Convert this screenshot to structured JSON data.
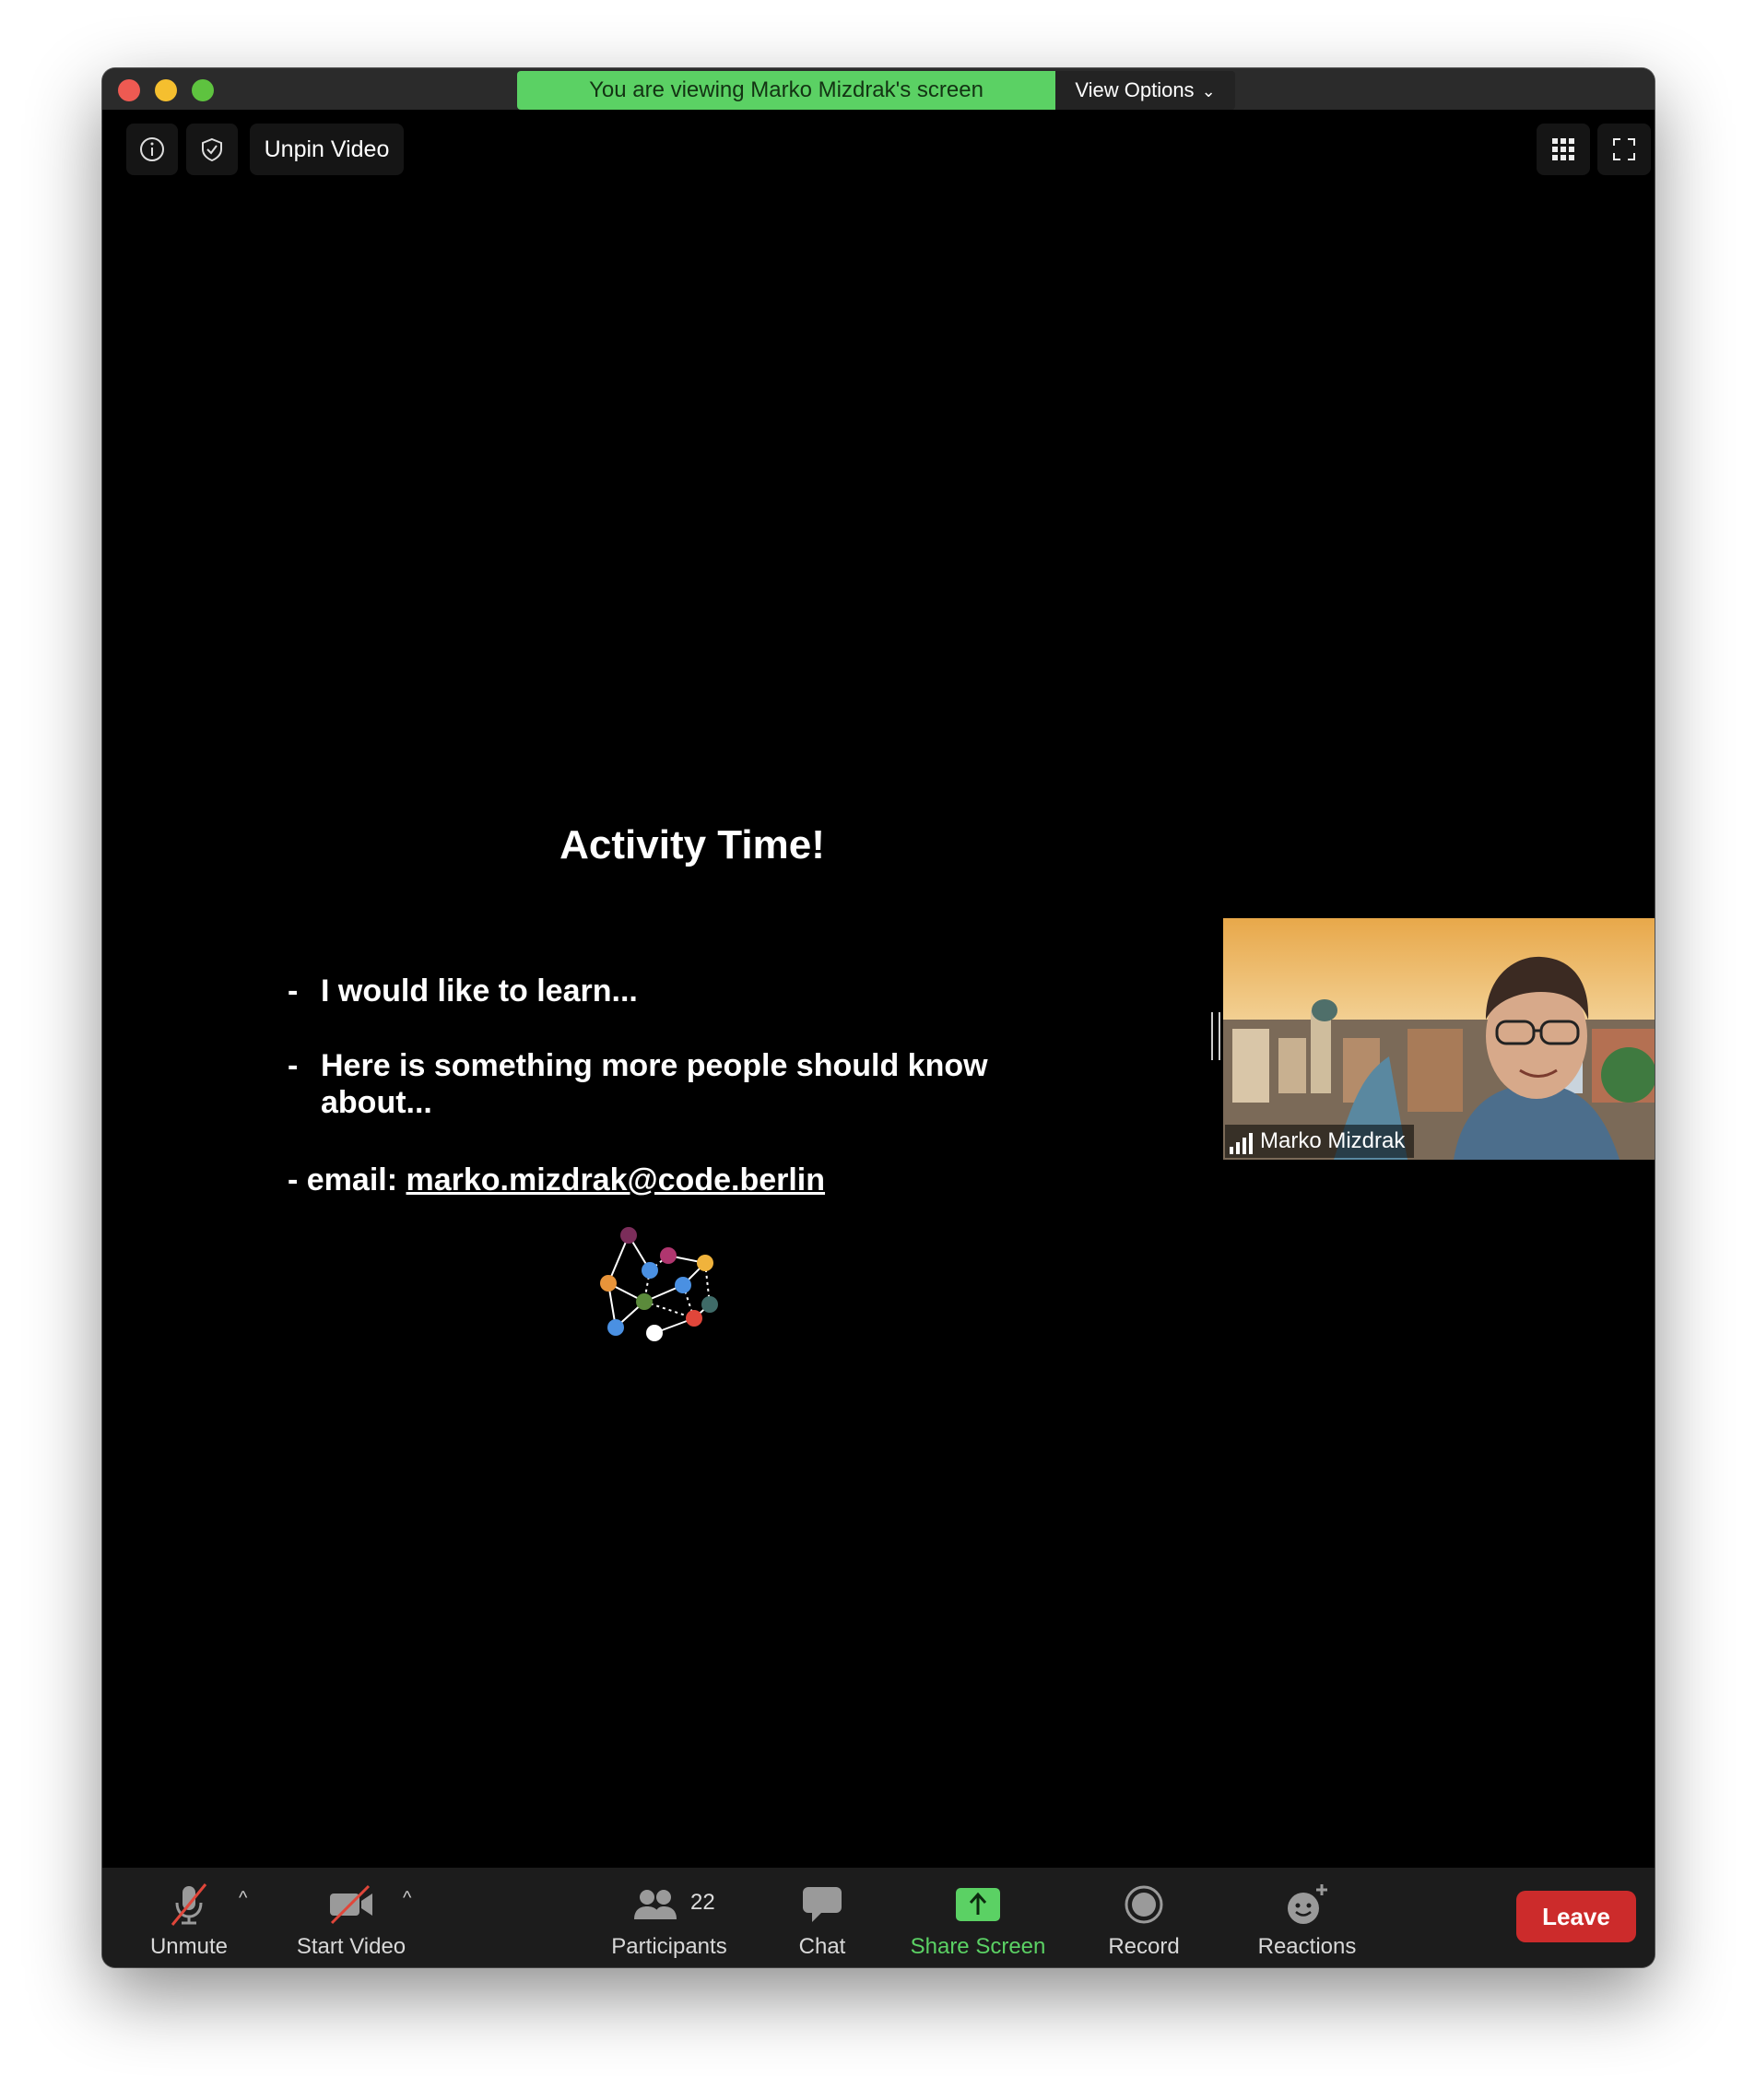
{
  "window": {
    "share_banner": "You are viewing Marko Mizdrak's screen",
    "view_options_label": "View Options"
  },
  "top_controls": {
    "unpin_label": "Unpin Video"
  },
  "slide": {
    "title": "Activity Time!",
    "bullets": [
      {
        "dash": "-",
        "text": "I would like to learn..."
      },
      {
        "dash": "-",
        "text": "Here is something more people should know about..."
      }
    ],
    "email_prefix": "- email:",
    "email_address": "marko.mizdrak@code.berlin",
    "logo_node_colors": [
      "#7b2d5a",
      "#b0366f",
      "#f0b33c",
      "#e8943a",
      "#4a90e2",
      "#5b8a3b",
      "#3f6b68",
      "#e0463a",
      "#ffffff"
    ]
  },
  "participant": {
    "name": "Marko Mizdrak"
  },
  "toolbar": {
    "unmute_label": "Unmute",
    "start_video_label": "Start Video",
    "participants_label": "Participants",
    "participants_count": "22",
    "chat_label": "Chat",
    "share_screen_label": "Share Screen",
    "record_label": "Record",
    "reactions_label": "Reactions",
    "leave_label": "Leave"
  },
  "colors": {
    "share_green": "#5bd164",
    "leave_red": "#cc2b2b",
    "mute_slash": "#e0463a"
  }
}
